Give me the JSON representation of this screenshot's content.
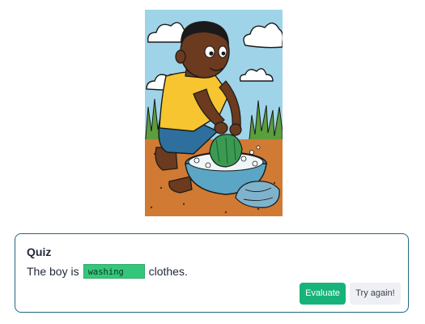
{
  "illustration": {
    "subject": "boy washing clothes in a basin",
    "colors": {
      "sky": "#9fd4e8",
      "ground": "#d07a34",
      "shirt": "#f6c530",
      "shorts": "#2e6f9e",
      "basin": "#5aa6c4",
      "cloth": "#3a9a52"
    }
  },
  "quiz": {
    "title": "Quiz",
    "sentence_before": "The boy is",
    "answer_value": "washing",
    "sentence_after": "clothes.",
    "answer_color": "#34c77b",
    "evaluate_label": "Evaluate",
    "retry_label": "Try again!",
    "accent_color": "#16b37a",
    "border_color": "#1e6a82"
  }
}
